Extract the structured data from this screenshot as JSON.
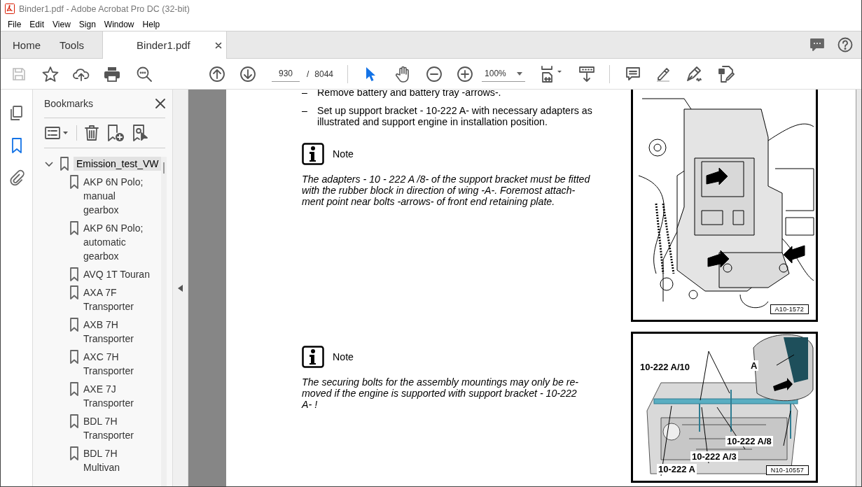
{
  "window": {
    "title": "Binder1.pdf - Adobe Acrobat Pro DC (32-bit)"
  },
  "menu_bar": [
    "File",
    "Edit",
    "View",
    "Sign",
    "Window",
    "Help"
  ],
  "tabs": [
    {
      "label": "Home",
      "selected": false
    },
    {
      "label": "Tools",
      "selected": false
    },
    {
      "label": "Binder1.pdf",
      "selected": true
    }
  ],
  "toolbar": {
    "save_disabled": true,
    "page_number": "930",
    "page_separator": "/",
    "page_total": "8044",
    "zoom": "100%",
    "tools": [
      {
        "kind": "select",
        "selected": true
      },
      {
        "kind": "hand",
        "selected": false
      }
    ]
  },
  "nav_rail": [
    {
      "kind": "pages",
      "selected": false
    },
    {
      "kind": "bookmarks",
      "selected": true
    },
    {
      "kind": "attachments",
      "selected": false
    }
  ],
  "bookmarks": {
    "title": "Bookmarks",
    "items": [
      {
        "label": "Emission_test_VW",
        "expanded": true,
        "selected": true,
        "children": [
          {
            "label": "AKP 6N Polo; manual gearbox",
            "selected": false
          },
          {
            "label": "AKP 6N Polo; automatic gearbox",
            "selected": false
          },
          {
            "label": "AVQ 1T Touran",
            "selected": false
          },
          {
            "label": "AXA 7F Transporter",
            "selected": false
          },
          {
            "label": "AXB 7H Transporter",
            "selected": false
          },
          {
            "label": "AXC 7H Transporter",
            "selected": false
          },
          {
            "label": "AXE 7J Transporter",
            "selected": false
          },
          {
            "label": "BDL 7H Transporter",
            "selected": false
          },
          {
            "label": "BDL 7H Multivan",
            "selected": false
          }
        ]
      }
    ]
  },
  "document": {
    "steps": [
      {
        "bullet": "–",
        "text": "Remove battery and battery tray -arrows-."
      },
      {
        "bullet": "–",
        "text": "Set up support bracket - 10-222 A- with necessary adapters as illustrated and support engine in installation position."
      }
    ],
    "notes": [
      {
        "title": "Note",
        "lines": [
          "The adapters - 10 - 222 A /8- of the support bracket must be fitted",
          "with the rubber block in direction of wing -A-. Foremost attach-",
          "ment point near bolts -arrows- of front end retaining plate."
        ]
      },
      {
        "title": "Note",
        "lines": [
          "The securing bolts for the assembly mountings may only be re-",
          "moved if the engine is supported with support bracket - 10-222",
          "A- !"
        ]
      }
    ],
    "figures": [
      {
        "kind": "battery-tray",
        "code": "A10-1572"
      },
      {
        "kind": "engine-bay",
        "code": "N10-10557",
        "labels": [
          "10-222 A/10",
          "A",
          "10-222 A/8",
          "10-222 A/3",
          "10-222 A"
        ]
      }
    ]
  }
}
